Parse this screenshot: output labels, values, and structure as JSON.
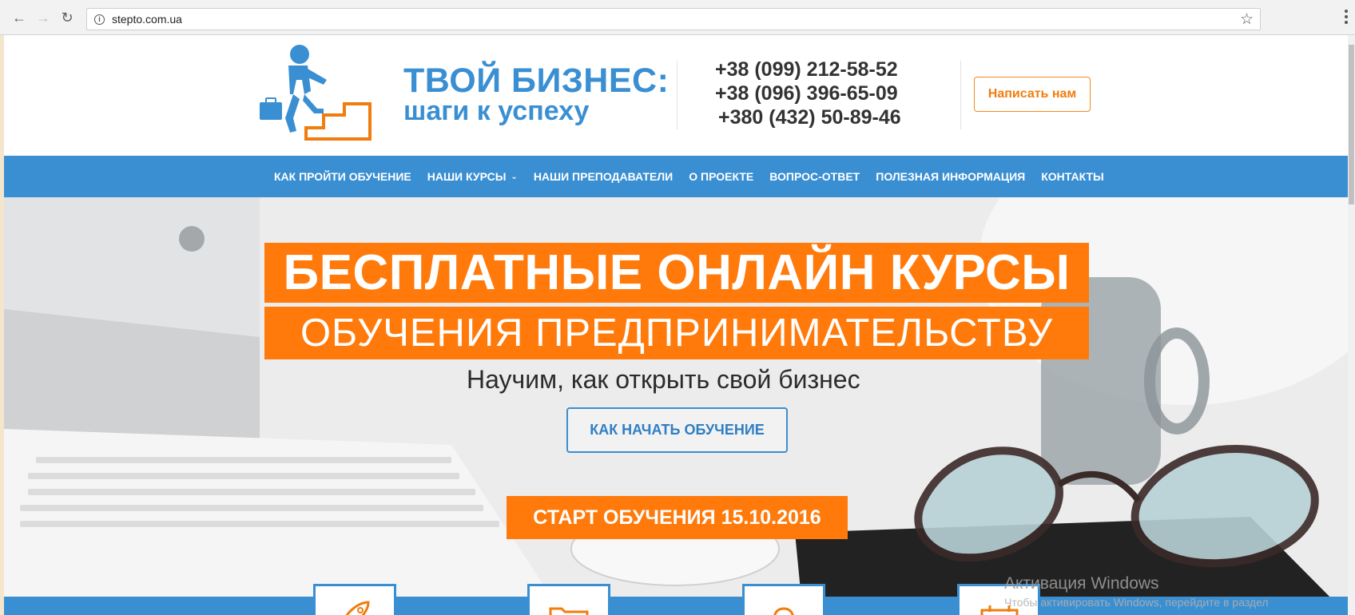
{
  "browser": {
    "back_icon": "arrow-left",
    "forward_icon": "arrow-right",
    "reload_icon": "reload",
    "url": "stepto.com.ua",
    "bookmark_icon": "star"
  },
  "header": {
    "brand_title": "ТВОЙ БИЗНЕС:",
    "brand_subtitle": "шаги к успеху",
    "phones": [
      "+38 (099) 212-58-52",
      "+38 (096) 396-65-09",
      "+380 (432) 50-89-46"
    ],
    "write_button": "Написать нам"
  },
  "nav": {
    "items": [
      {
        "label": "КАК ПРОЙТИ ОБУЧЕНИЕ"
      },
      {
        "label": "НАШИ КУРСЫ",
        "has_dropdown": true
      },
      {
        "label": "НАШИ ПРЕПОДАВАТЕЛИ"
      },
      {
        "label": "О ПРОЕКТЕ"
      },
      {
        "label": "ВОПРОС-ОТВЕТ"
      },
      {
        "label": "ПОЛЕЗНАЯ ИНФОРМАЦИЯ"
      },
      {
        "label": "КОНТАКТЫ"
      }
    ]
  },
  "hero": {
    "headline": "БЕСПЛАТНЫЕ ОНЛАЙН КУРСЫ",
    "subheadline": "ОБУЧЕНИЯ ПРЕДПРИНИМАТЕЛЬСТВУ",
    "tagline": "Научим, как открыть свой бизнес",
    "cta_button": "КАК НАЧАТЬ ОБУЧЕНИЕ",
    "start_date": "СТАРТ ОБУЧЕНИЯ 15.10.2016"
  },
  "features": {
    "icons": [
      "rocket-icon",
      "folder-icon",
      "teacher-icon",
      "calendar-icon"
    ]
  },
  "watermark": {
    "title": "Активация Windows",
    "subtitle": "Чтобы активировать Windows, перейдите в раздел"
  },
  "colors": {
    "brand_blue": "#3a8fd3",
    "brand_orange": "#ff7a0b"
  }
}
